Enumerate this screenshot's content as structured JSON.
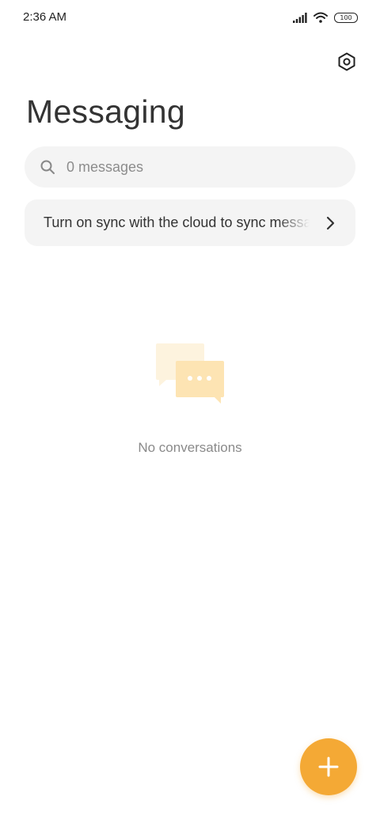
{
  "status_bar": {
    "time": "2:36 AM",
    "battery": "100",
    "icons": [
      "signal-icon",
      "wifi-icon",
      "battery-icon"
    ]
  },
  "header": {
    "title": "Messaging",
    "settings_icon": "settings-icon"
  },
  "search": {
    "placeholder": "0 messages",
    "value": ""
  },
  "sync_banner": {
    "text": "Turn on sync with the cloud to sync messages"
  },
  "empty_state": {
    "icon": "chat-bubbles-icon",
    "text": "No conversations"
  },
  "fab": {
    "icon": "plus-icon"
  },
  "colors": {
    "accent": "#f4a935",
    "surface": "#f4f4f4",
    "text_primary": "#333333",
    "text_secondary": "#8a8a8a"
  }
}
